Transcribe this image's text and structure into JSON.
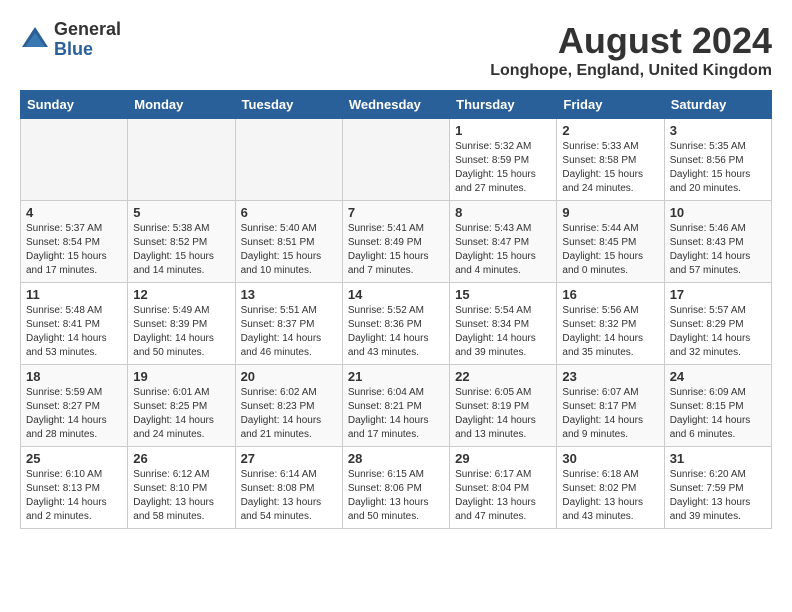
{
  "header": {
    "logo_general": "General",
    "logo_blue": "Blue",
    "month_year": "August 2024",
    "location": "Longhope, England, United Kingdom"
  },
  "weekdays": [
    "Sunday",
    "Monday",
    "Tuesday",
    "Wednesday",
    "Thursday",
    "Friday",
    "Saturday"
  ],
  "weeks": [
    [
      {
        "day": "",
        "info": ""
      },
      {
        "day": "",
        "info": ""
      },
      {
        "day": "",
        "info": ""
      },
      {
        "day": "",
        "info": ""
      },
      {
        "day": "1",
        "info": "Sunrise: 5:32 AM\nSunset: 8:59 PM\nDaylight: 15 hours and 27 minutes."
      },
      {
        "day": "2",
        "info": "Sunrise: 5:33 AM\nSunset: 8:58 PM\nDaylight: 15 hours and 24 minutes."
      },
      {
        "day": "3",
        "info": "Sunrise: 5:35 AM\nSunset: 8:56 PM\nDaylight: 15 hours and 20 minutes."
      }
    ],
    [
      {
        "day": "4",
        "info": "Sunrise: 5:37 AM\nSunset: 8:54 PM\nDaylight: 15 hours and 17 minutes."
      },
      {
        "day": "5",
        "info": "Sunrise: 5:38 AM\nSunset: 8:52 PM\nDaylight: 15 hours and 14 minutes."
      },
      {
        "day": "6",
        "info": "Sunrise: 5:40 AM\nSunset: 8:51 PM\nDaylight: 15 hours and 10 minutes."
      },
      {
        "day": "7",
        "info": "Sunrise: 5:41 AM\nSunset: 8:49 PM\nDaylight: 15 hours and 7 minutes."
      },
      {
        "day": "8",
        "info": "Sunrise: 5:43 AM\nSunset: 8:47 PM\nDaylight: 15 hours and 4 minutes."
      },
      {
        "day": "9",
        "info": "Sunrise: 5:44 AM\nSunset: 8:45 PM\nDaylight: 15 hours and 0 minutes."
      },
      {
        "day": "10",
        "info": "Sunrise: 5:46 AM\nSunset: 8:43 PM\nDaylight: 14 hours and 57 minutes."
      }
    ],
    [
      {
        "day": "11",
        "info": "Sunrise: 5:48 AM\nSunset: 8:41 PM\nDaylight: 14 hours and 53 minutes."
      },
      {
        "day": "12",
        "info": "Sunrise: 5:49 AM\nSunset: 8:39 PM\nDaylight: 14 hours and 50 minutes."
      },
      {
        "day": "13",
        "info": "Sunrise: 5:51 AM\nSunset: 8:37 PM\nDaylight: 14 hours and 46 minutes."
      },
      {
        "day": "14",
        "info": "Sunrise: 5:52 AM\nSunset: 8:36 PM\nDaylight: 14 hours and 43 minutes."
      },
      {
        "day": "15",
        "info": "Sunrise: 5:54 AM\nSunset: 8:34 PM\nDaylight: 14 hours and 39 minutes."
      },
      {
        "day": "16",
        "info": "Sunrise: 5:56 AM\nSunset: 8:32 PM\nDaylight: 14 hours and 35 minutes."
      },
      {
        "day": "17",
        "info": "Sunrise: 5:57 AM\nSunset: 8:29 PM\nDaylight: 14 hours and 32 minutes."
      }
    ],
    [
      {
        "day": "18",
        "info": "Sunrise: 5:59 AM\nSunset: 8:27 PM\nDaylight: 14 hours and 28 minutes."
      },
      {
        "day": "19",
        "info": "Sunrise: 6:01 AM\nSunset: 8:25 PM\nDaylight: 14 hours and 24 minutes."
      },
      {
        "day": "20",
        "info": "Sunrise: 6:02 AM\nSunset: 8:23 PM\nDaylight: 14 hours and 21 minutes."
      },
      {
        "day": "21",
        "info": "Sunrise: 6:04 AM\nSunset: 8:21 PM\nDaylight: 14 hours and 17 minutes."
      },
      {
        "day": "22",
        "info": "Sunrise: 6:05 AM\nSunset: 8:19 PM\nDaylight: 14 hours and 13 minutes."
      },
      {
        "day": "23",
        "info": "Sunrise: 6:07 AM\nSunset: 8:17 PM\nDaylight: 14 hours and 9 minutes."
      },
      {
        "day": "24",
        "info": "Sunrise: 6:09 AM\nSunset: 8:15 PM\nDaylight: 14 hours and 6 minutes."
      }
    ],
    [
      {
        "day": "25",
        "info": "Sunrise: 6:10 AM\nSunset: 8:13 PM\nDaylight: 14 hours and 2 minutes."
      },
      {
        "day": "26",
        "info": "Sunrise: 6:12 AM\nSunset: 8:10 PM\nDaylight: 13 hours and 58 minutes."
      },
      {
        "day": "27",
        "info": "Sunrise: 6:14 AM\nSunset: 8:08 PM\nDaylight: 13 hours and 54 minutes."
      },
      {
        "day": "28",
        "info": "Sunrise: 6:15 AM\nSunset: 8:06 PM\nDaylight: 13 hours and 50 minutes."
      },
      {
        "day": "29",
        "info": "Sunrise: 6:17 AM\nSunset: 8:04 PM\nDaylight: 13 hours and 47 minutes."
      },
      {
        "day": "30",
        "info": "Sunrise: 6:18 AM\nSunset: 8:02 PM\nDaylight: 13 hours and 43 minutes."
      },
      {
        "day": "31",
        "info": "Sunrise: 6:20 AM\nSunset: 7:59 PM\nDaylight: 13 hours and 39 minutes."
      }
    ]
  ]
}
